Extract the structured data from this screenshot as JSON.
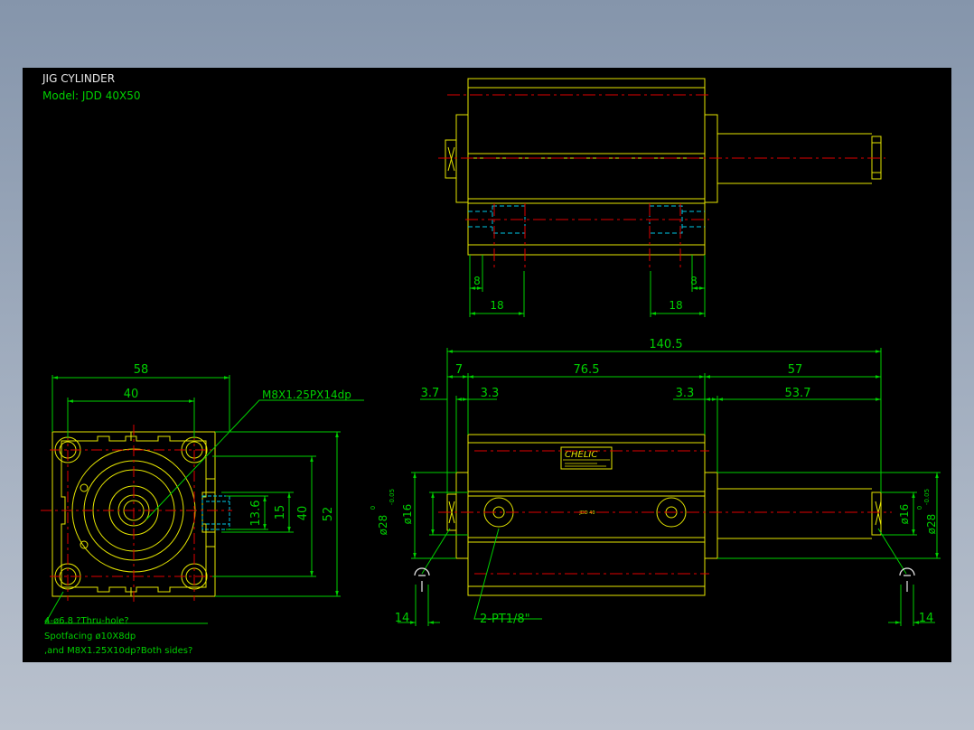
{
  "title": {
    "line1": "JIG CYLINDER",
    "line2": "Model:  JDD  40X50"
  },
  "colors": {
    "background": "#000000",
    "outline": "#e6e600",
    "dimension": "#00d000",
    "centerline": "#e00000",
    "hidden": "#00c8e6",
    "text_white": "#e8e8e8"
  },
  "top_view": {
    "dims": {
      "left_small": "8",
      "left_large": "18",
      "right_large": "18",
      "right_small": "8"
    }
  },
  "end_view": {
    "dims": {
      "width_overall": "58",
      "width_holes": "40",
      "height_port": "13.6",
      "height_15": "15",
      "height_40": "40",
      "height_52": "52"
    },
    "callout_thread": "M8X1.25PX14dp",
    "note_lines": [
      "4-ø6.8 ?Thru-hole?",
      "Spotfacing ø10X8dp",
      ",and M8X1.25X10dp?Both sides?"
    ]
  },
  "front_view": {
    "dims": {
      "overall": "140.5",
      "d7": "7",
      "d76_5": "76.5",
      "d57": "57",
      "d3_7": "3.7",
      "d3_3_left": "3.3",
      "d3_3_right": "3.3",
      "d53_7": "53.7",
      "dia16_left": "ø16",
      "dia28_left": "ø28",
      "tol28_left": "-0.05",
      "tol28_left_upper": "0",
      "dia16_right": "ø16",
      "dia28_right": "ø28",
      "tol28_right": "-0.05",
      "tol28_right_upper": "0",
      "d14_left": "14",
      "d14_right": "14"
    },
    "port_callout": "2-PT1/8\"",
    "label_brand": "CHELIC",
    "label_small": "JDD  40"
  }
}
